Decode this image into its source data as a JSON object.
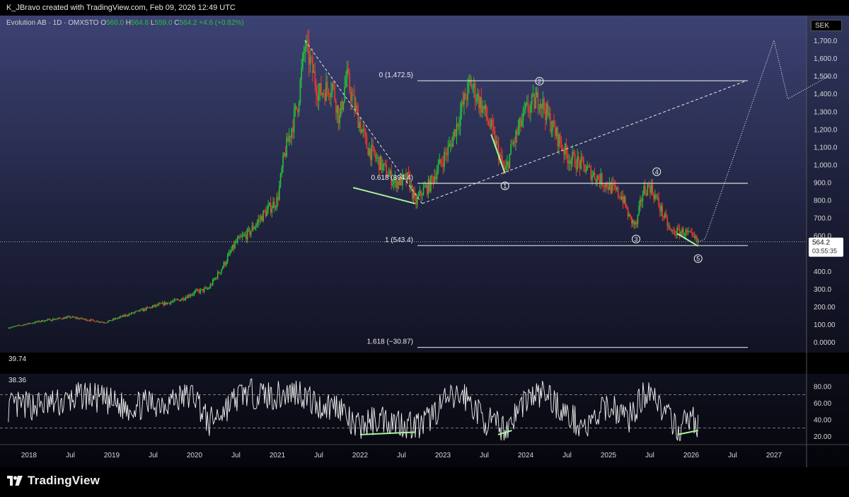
{
  "header": {
    "attribution": "K_JBravo created with TradingView.com, Feb 09, 2026 12:49 UTC"
  },
  "legend": {
    "symbol": "Evolution AB · 1D · OMXSTO",
    "open_label": "O",
    "open": "560.0",
    "high_label": "H",
    "high": "564.6",
    "low_label": "L",
    "low": "559.0",
    "close_label": "C",
    "close": "564.2",
    "change": "+4.6 (+0.82%)"
  },
  "currency": "SEK",
  "price_tag": {
    "price": "564.2",
    "countdown": "03:55:35"
  },
  "brand": {
    "name": "TradingView"
  },
  "colors": {
    "up": "#26c23a",
    "down": "#ef3b2c",
    "fib_line": "#dcdcdc",
    "divergence": "#a6f59a",
    "rsi_line": "#f2f2f2"
  },
  "chart_data": [
    {
      "type": "line",
      "title": "Evolution AB · 1D · OMXSTO",
      "y_unit": "SEK",
      "ylim": [
        -60,
        1840
      ],
      "xlim": [
        "2017-09",
        "2027-09"
      ],
      "y_ticks": [
        "0.0000",
        "100.00",
        "200.00",
        "300.0",
        "400.0",
        "500.0",
        "600.0",
        "700.0",
        "800.0",
        "900.0",
        "1,000.0",
        "1,100.0",
        "1,200.0",
        "1,300.0",
        "1,400.0",
        "1,500.0",
        "1,600.0",
        "1,700.0",
        "1,800.0"
      ],
      "y_tick_values": [
        0,
        100,
        200,
        300,
        400,
        500,
        600,
        700,
        800,
        900,
        1000,
        1100,
        1200,
        1300,
        1400,
        1500,
        1600,
        1700,
        1800
      ],
      "x_ticks": [
        "2018",
        "Jul",
        "2019",
        "Jul",
        "2020",
        "Jul",
        "2021",
        "Jul",
        "2022",
        "Jul",
        "2023",
        "Jul",
        "2024",
        "Jul",
        "2025",
        "Jul",
        "2026",
        "Jul",
        "2027"
      ],
      "x_tick_dates": [
        "2018-01",
        "2018-07",
        "2019-01",
        "2019-07",
        "2020-01",
        "2020-07",
        "2021-01",
        "2021-07",
        "2022-01",
        "2022-07",
        "2023-01",
        "2023-07",
        "2024-01",
        "2024-07",
        "2025-01",
        "2025-07",
        "2026-01",
        "2026-07",
        "2027-01"
      ],
      "price_path": {
        "dates": [
          "2017-10",
          "2018-03",
          "2018-07",
          "2018-12",
          "2019-03",
          "2019-07",
          "2019-11",
          "2020-01",
          "2020-03",
          "2020-05",
          "2020-07",
          "2020-09",
          "2020-11",
          "2021-01",
          "2021-02",
          "2021-04",
          "2021-05",
          "2021-07",
          "2021-09",
          "2021-10",
          "2021-11",
          "2021-12",
          "2022-02",
          "2022-04",
          "2022-06",
          "2022-08",
          "2022-09",
          "2022-10",
          "2022-11",
          "2022-12",
          "2023-02",
          "2023-04",
          "2023-05",
          "2023-07",
          "2023-08",
          "2023-10",
          "2023-11",
          "2024-01",
          "2024-03",
          "2024-05",
          "2024-07",
          "2024-09",
          "2024-11",
          "2025-01",
          "2025-03",
          "2025-04",
          "2025-05",
          "2025-06",
          "2025-07",
          "2025-08",
          "2025-10",
          "2025-12",
          "2026-02"
        ],
        "values": [
          80,
          120,
          140,
          110,
          150,
          200,
          240,
          280,
          300,
          420,
          560,
          620,
          720,
          800,
          1050,
          1350,
          1680,
          1400,
          1450,
          1250,
          1500,
          1350,
          1100,
          1000,
          900,
          920,
          780,
          850,
          880,
          960,
          1100,
          1350,
          1460,
          1300,
          1200,
          950,
          1100,
          1300,
          1380,
          1200,
          1050,
          1000,
          940,
          880,
          820,
          700,
          650,
          850,
          880,
          800,
          620,
          620,
          564
        ]
      },
      "fib_levels": [
        {
          "label": "0 (1,472.5)",
          "value": 1472.5
        },
        {
          "label": "0.618 (894.4)",
          "value": 894.4
        },
        {
          "label": "1 (543.4)",
          "value": 543.4
        },
        {
          "label": "1.618 (−30.87)",
          "value": -30.87
        }
      ],
      "wave_labels": [
        {
          "label": "1",
          "date": "2023-10",
          "value": 880
        },
        {
          "label": "2",
          "date": "2024-03",
          "value": 1470
        },
        {
          "label": "3",
          "date": "2025-05",
          "value": 580
        },
        {
          "label": "4",
          "date": "2025-08",
          "value": 960
        },
        {
          "label": "5",
          "date": "2026-02",
          "value": 470
        }
      ],
      "dashed_lines": [
        {
          "from": [
            "2021-05",
            1700
          ],
          "to": [
            "2022-10",
            780
          ]
        },
        {
          "from": [
            "2022-10",
            780
          ],
          "to": [
            "2026-09",
            1472.5
          ]
        }
      ],
      "projection_path": {
        "dates": [
          "2026-02",
          "2026-03",
          "2027-01",
          "2027-03",
          "2027-09"
        ],
        "values": [
          564,
          580,
          1700,
          1370,
          1500
        ]
      },
      "divergence_lines": [
        {
          "from": [
            "2021-12",
            870
          ],
          "to": [
            "2022-09",
            780
          ]
        },
        {
          "from": [
            "2023-08",
            1170
          ],
          "to": [
            "2023-10",
            950
          ]
        },
        {
          "from": [
            "2025-11",
            610
          ],
          "to": [
            "2026-02",
            540
          ]
        }
      ],
      "last_price": 564.2
    },
    {
      "type": "line",
      "title": "39.74",
      "value_label": "38.36",
      "ylim": [
        10,
        95
      ],
      "y_ticks": [
        "20.00",
        "40.00",
        "60.00",
        "80.00"
      ],
      "y_tick_values": [
        20,
        40,
        60,
        80
      ],
      "bands": [
        70,
        30
      ],
      "rsi_anchors": {
        "dates": [
          "2017-10",
          "2018-06",
          "2018-09",
          "2019-03",
          "2019-09",
          "2020-01",
          "2020-03",
          "2020-08",
          "2021-01",
          "2021-04",
          "2021-07",
          "2021-10",
          "2021-12",
          "2022-04",
          "2022-08",
          "2022-10",
          "2023-01",
          "2023-04",
          "2023-07",
          "2023-10",
          "2024-01",
          "2024-04",
          "2024-07",
          "2024-10",
          "2025-01",
          "2025-04",
          "2025-07",
          "2025-09",
          "2025-11",
          "2026-01",
          "2026-02"
        ],
        "values": [
          55,
          60,
          70,
          55,
          62,
          70,
          35,
          72,
          68,
          75,
          55,
          58,
          30,
          42,
          35,
          32,
          60,
          70,
          40,
          28,
          65,
          72,
          45,
          30,
          58,
          42,
          80,
          50,
          25,
          45,
          30
        ]
      },
      "divergence_lines": [
        {
          "from": [
            "2022-01",
            22
          ],
          "to": [
            "2022-09",
            25
          ]
        },
        {
          "from": [
            "2023-09",
            22
          ],
          "to": [
            "2023-11",
            27
          ]
        },
        {
          "from": [
            "2025-11",
            22
          ],
          "to": [
            "2026-02",
            27
          ]
        }
      ]
    }
  ]
}
